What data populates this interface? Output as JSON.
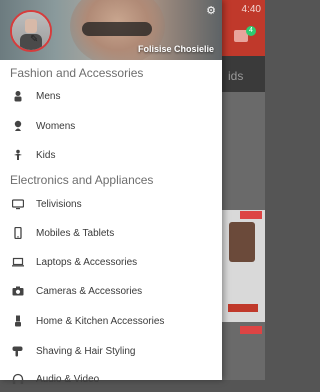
{
  "status_bar": {
    "time": "4:40"
  },
  "cart": {
    "badge": "4"
  },
  "tab_partial": "ids",
  "drawer": {
    "user_name": "Folisise Chosielie",
    "sections": [
      {
        "title": "Fashion and Accessories",
        "items": [
          {
            "label": "Mens",
            "icon": "man-icon"
          },
          {
            "label": "Womens",
            "icon": "woman-icon"
          },
          {
            "label": "Kids",
            "icon": "kid-icon"
          }
        ]
      },
      {
        "title": "Electronics and Appliances",
        "items": [
          {
            "label": "Telivisions",
            "icon": "tv-icon"
          },
          {
            "label": "Mobiles & Tablets",
            "icon": "mobile-icon"
          },
          {
            "label": "Laptops & Accessories",
            "icon": "laptop-icon"
          },
          {
            "label": "Cameras & Accessories",
            "icon": "camera-icon"
          },
          {
            "label": "Home & Kitchen Accessories",
            "icon": "blender-icon"
          },
          {
            "label": "Shaving & Hair Styling",
            "icon": "hairdryer-icon"
          },
          {
            "label": "Audio & Video",
            "icon": "headphones-icon"
          }
        ]
      }
    ]
  },
  "colors": {
    "accent": "#c0392b",
    "avatar_ring": "#d63c3c"
  }
}
